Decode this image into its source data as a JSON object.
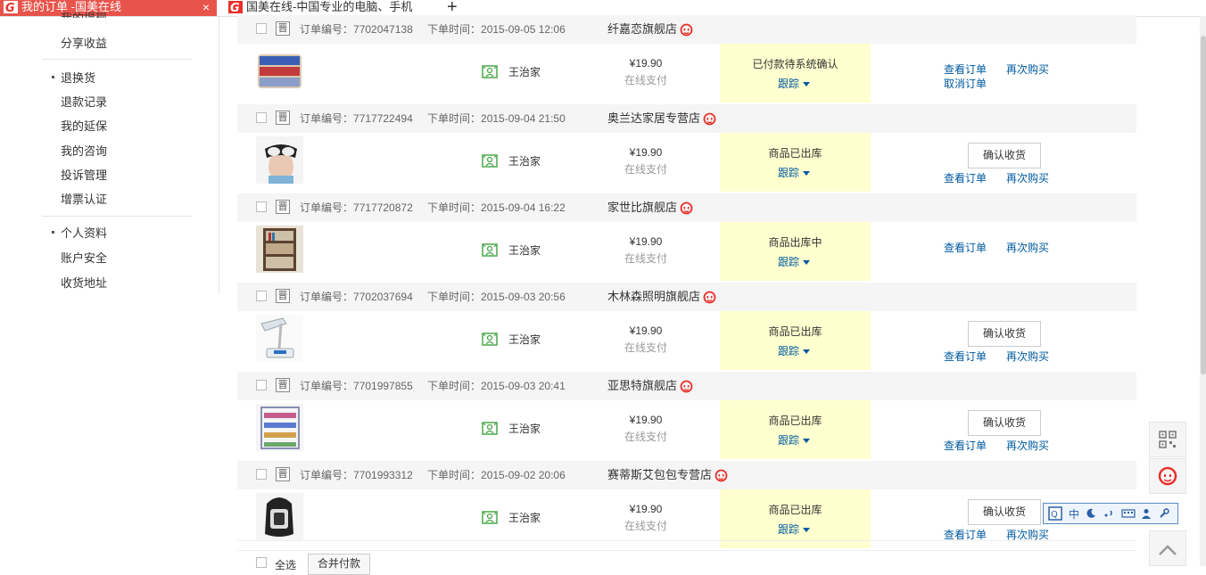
{
  "tabs": [
    {
      "title": "我的订单 -国美在线",
      "active": true
    },
    {
      "title": "国美在线-中国专业的电脑、手机",
      "active": false
    }
  ],
  "new_tab": "+",
  "tab_close": "×",
  "sidebar": {
    "top_item": "我的提现",
    "group1": [
      "分享收益"
    ],
    "group2_head": "退换货",
    "group2": [
      "退款记录",
      "我的延保",
      "我的咨询",
      "投诉管理",
      "增票认证"
    ],
    "group3_head": "个人资料",
    "group3": [
      "账户安全",
      "收货地址"
    ]
  },
  "labels": {
    "order_no": "订单编号：",
    "order_time": "下单时间：",
    "track": "跟踪",
    "view": "查看订单",
    "rebuy": "再次购买",
    "cancel": "取消订单",
    "confirm": "确认收货",
    "pin": "晋"
  },
  "orders": [
    {
      "id": "7702047138",
      "time": "2015-09-05 12:06",
      "shop": "纤嘉恋旗舰店",
      "person": "王治家",
      "price": "¥19.90",
      "pay": "在线支付",
      "status": "已付款待系统确认",
      "confirm": false,
      "cancel": true,
      "thumb": "pillow"
    },
    {
      "id": "7717722494",
      "time": "2015-09-04 21:50",
      "shop": "奥兰达家居专营店",
      "person": "王治家",
      "price": "¥19.90",
      "pay": "在线支付",
      "status": "商品已出库",
      "confirm": true,
      "cancel": false,
      "thumb": "eyemask"
    },
    {
      "id": "7717720872",
      "time": "2015-09-04 16:22",
      "shop": "家世比旗舰店",
      "person": "王治家",
      "price": "¥19.90",
      "pay": "在线支付",
      "status": "商品出库中",
      "confirm": false,
      "cancel": false,
      "thumb": "shelf"
    },
    {
      "id": "7702037694",
      "time": "2015-09-03 20:56",
      "shop": "木林森照明旗舰店",
      "person": "王治家",
      "price": "¥19.90",
      "pay": "在线支付",
      "status": "商品已出库",
      "confirm": true,
      "cancel": false,
      "thumb": "lamp"
    },
    {
      "id": "7701997855",
      "time": "2015-09-03 20:41",
      "shop": "亚思特旗舰店",
      "person": "王治家",
      "price": "¥19.90",
      "pay": "在线支付",
      "status": "商品已出库",
      "confirm": true,
      "cancel": false,
      "thumb": "shoerack"
    },
    {
      "id": "7701993312",
      "time": "2015-09-02 20:06",
      "shop": "赛蒂斯艾包包专营店",
      "person": "王治家",
      "price": "¥19.90",
      "pay": "在线支付",
      "status": "商品已出库",
      "confirm": true,
      "cancel": false,
      "thumb": "backpack"
    }
  ],
  "footer": {
    "select_all": "全选",
    "merge_pay": "合并付款"
  },
  "ime": {
    "mode": "中",
    "icons": [
      "moon-icon",
      "punctuation-icon",
      "keyboard-icon",
      "user-icon",
      "wrench-icon"
    ]
  },
  "colors": {
    "tab_active": "#e8544c",
    "link": "#005aa0",
    "status_bg": "#ffffcf",
    "brand_red": "#e8302a"
  }
}
